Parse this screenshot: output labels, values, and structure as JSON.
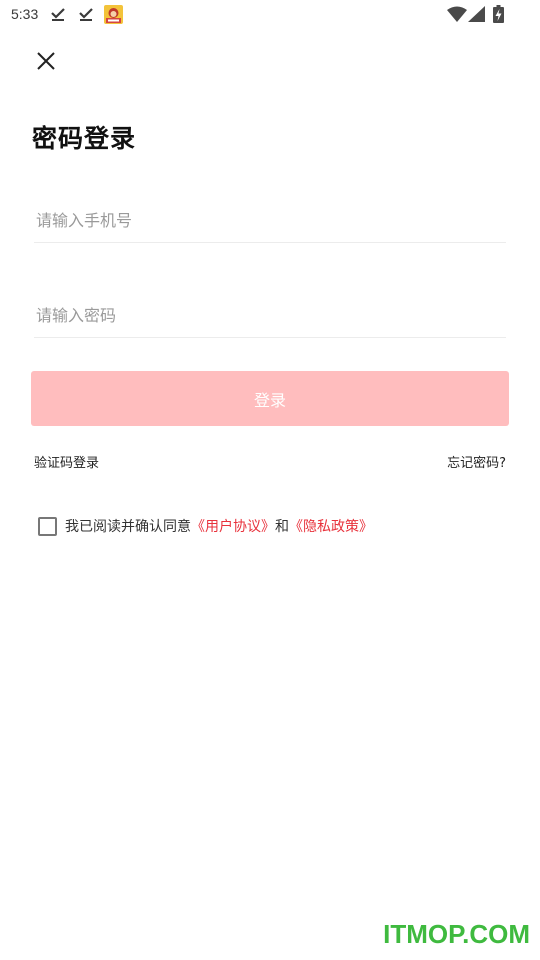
{
  "status_bar": {
    "time": "5:33",
    "icons": [
      "download-done-icon",
      "download-done-icon",
      "app-notification-icon",
      "wifi-icon",
      "signal-icon",
      "battery-charging-icon"
    ]
  },
  "header": {
    "close_icon": "close-icon",
    "title": "密码登录"
  },
  "form": {
    "phone_placeholder": "请输入手机号",
    "phone_value": "",
    "password_placeholder": "请输入密码",
    "password_value": "",
    "login_label": "登录",
    "login_color": "#ffbdbe"
  },
  "links": {
    "sms_login": "验证码登录",
    "forgot_password": "忘记密码?"
  },
  "agreement": {
    "checked": false,
    "prefix": "我已阅读并确认同意",
    "user_agreement": "《用户协议》",
    "conjunction": "和",
    "privacy_policy": "《隐私政策》",
    "link_color": "#e8323c"
  },
  "watermark": "ITMOP.COM"
}
